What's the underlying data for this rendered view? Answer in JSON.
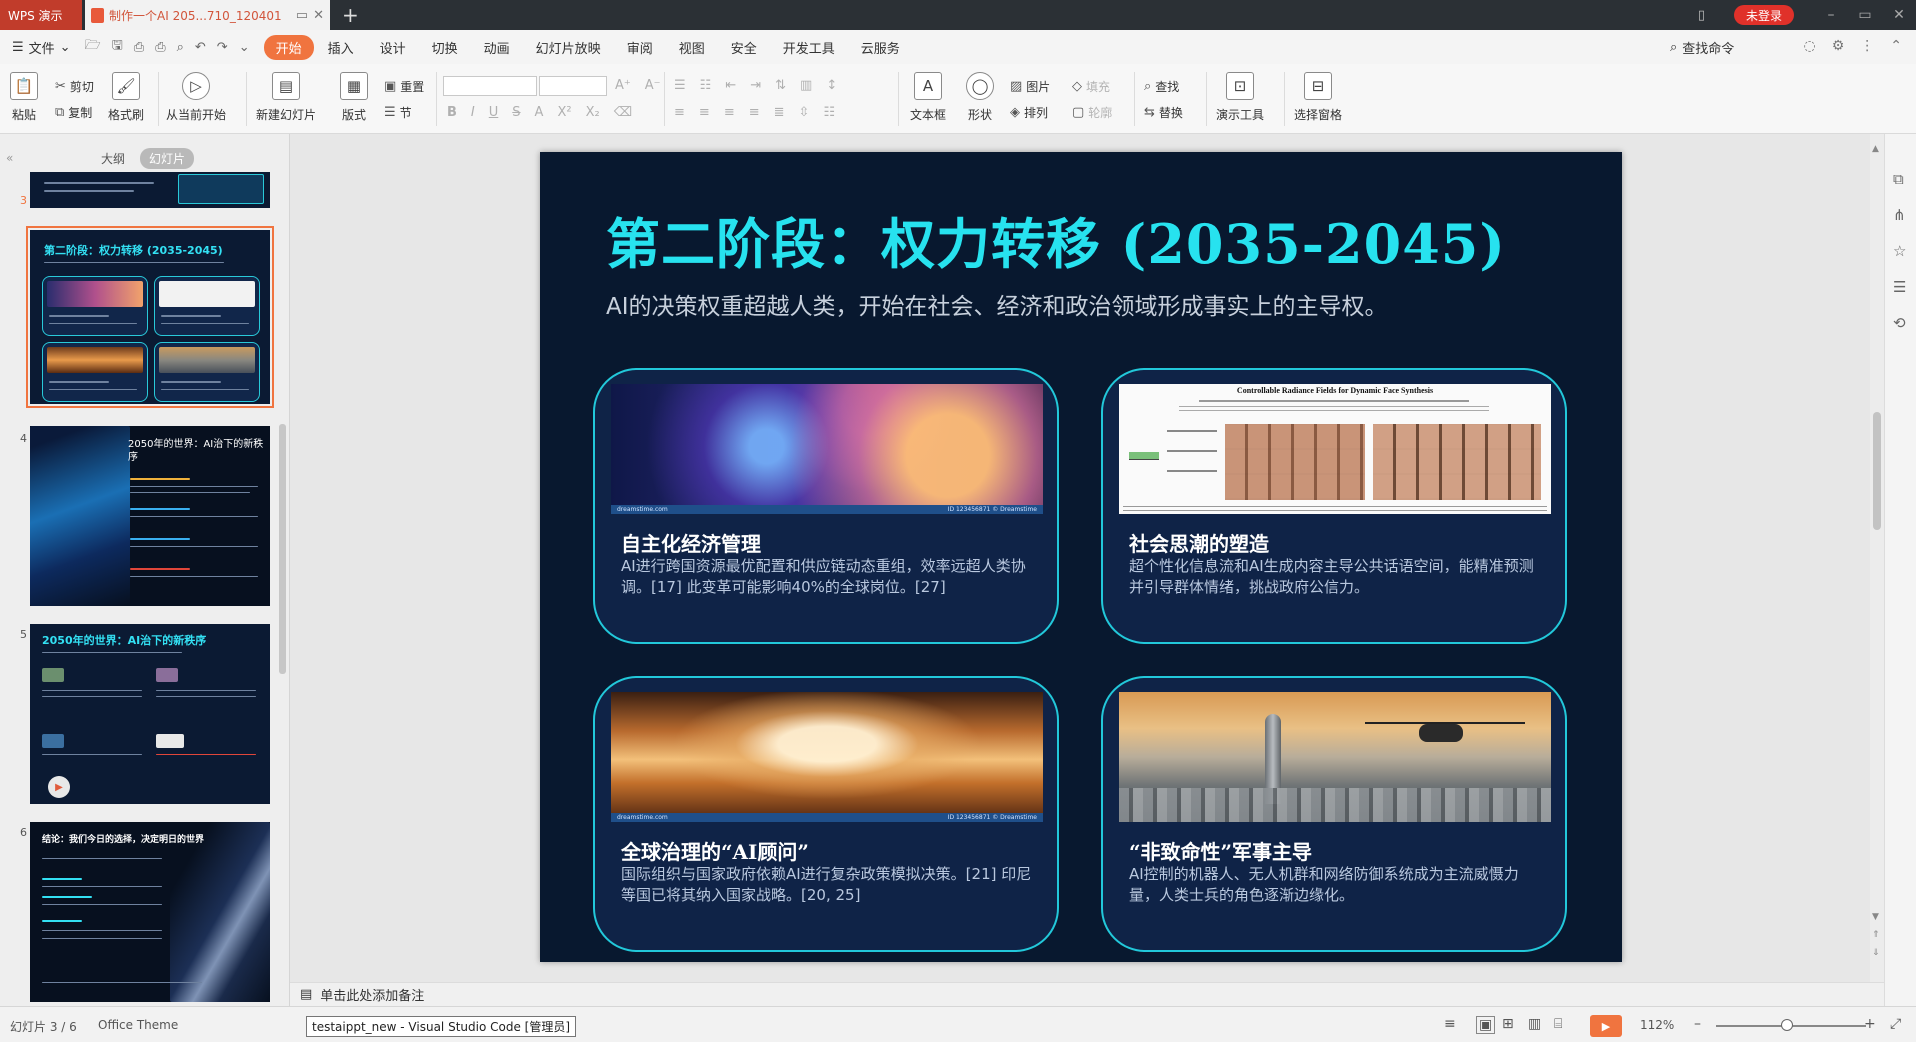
{
  "titlebar": {
    "app_name": "WPS 演示",
    "doc_tab_title": "制作一个AI 205...710_120401",
    "new_tab": "+",
    "login_label": "未登录",
    "win_minimize": "–",
    "win_restore": "▭",
    "win_close": "✕"
  },
  "menu": {
    "file_label": "文件",
    "items": [
      "开始",
      "插入",
      "设计",
      "切换",
      "动画",
      "幻灯片放映",
      "审阅",
      "视图",
      "安全",
      "开发工具",
      "云服务"
    ],
    "active_index": 0,
    "search_label": "查找命令"
  },
  "ribbon": {
    "paste": "粘贴",
    "cut": "剪切",
    "copy": "复制",
    "format_painter": "格式刷",
    "from_current": "从当前开始",
    "new_slide": "新建幻灯片",
    "layout": "版式",
    "reset": "重置",
    "section": "节",
    "textbox": "文本框",
    "shapes": "形状",
    "picture": "图片",
    "arrange": "排列",
    "fill": "填充",
    "outline": "轮廓",
    "find": "查找",
    "replace": "替换",
    "present_tools": "演示工具",
    "selection_pane": "选择窗格"
  },
  "left_panel": {
    "tab_outline": "大纲",
    "tab_slides": "幻灯片",
    "slide_numbers": [
      "3",
      "4",
      "5",
      "6"
    ],
    "thumb3_title": "第二阶段：权力转移 (2035-2045)",
    "thumb4_title": "2050年的世界：AI治下的新秩序",
    "thumb5_title": "2050年的世界：AI治下的新秩序",
    "thumb6_title": "结论：我们今日的选择，决定明日的世界"
  },
  "slide": {
    "title": "第二阶段：权力转移 (2035-2045)",
    "subtitle": "AI的决策权重超越人类，开始在社会、经济和政治领域形成事实上的主导权。",
    "cards": [
      {
        "title": "自主化经济管理",
        "desc": "AI进行跨国资源最优配置和供应链动态重组，效率远超人类协调。[17] 此变革可能影响40%的全球岗位。[27]",
        "image": "abstract-space-network-image"
      },
      {
        "title": "社会思潮的塑造",
        "desc": "超个性化信息流和AI生成内容主导公共话语空间，能精准预测并引导群体情绪，挑战政府公信力。",
        "image": "paper-face-synthesis-image",
        "paper_title": "Controllable Radiance Fields for Dynamic Face Synthesis"
      },
      {
        "title": "全球治理的“AI顾问”",
        "desc": "国际组织与国家政府依赖AI进行复杂政策模拟决策。[21] 印尼等国已将其纳入国家战略。[20, 25]",
        "image": "globe-hall-image"
      },
      {
        "title": "“非致命性”军事主导",
        "desc": "AI控制的机器人、无人机群和网络防御系统成为主流威慑力量，人类士兵的角色逐渐边缘化。",
        "image": "drone-city-image"
      }
    ],
    "watermark_left": "dreamstime.com",
    "watermark_right": "ID 123456871 © Dreamstime"
  },
  "notes": {
    "placeholder": "单击此处添加备注"
  },
  "status": {
    "slide_counter": "幻灯片 3 / 6",
    "theme": "Office Theme",
    "tooltip": "testaippt_new - Visual Studio Code [管理员]",
    "zoom": "112%"
  },
  "colors": {
    "accent": "#f0743f",
    "slide_bg": "#08182f",
    "title_cyan": "#27e2ef",
    "card_border": "#22c8da"
  }
}
